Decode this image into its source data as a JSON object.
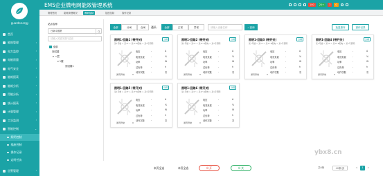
{
  "app": {
    "title": "EMS企业微电网能效管理系统",
    "username": "guardenergy",
    "brand_color": "#1ba3a6",
    "watermark": "ybx8.cn"
  },
  "topbar": {
    "badges": [
      {
        "label": "100",
        "color": "#e74c3c"
      },
      {
        "label": "20+",
        "color": "#27ae60"
      },
      {
        "label": "7",
        "color": "#e74c3c"
      },
      {
        "label": "0",
        "color": "#f39c12"
      }
    ]
  },
  "sidebar": {
    "items": [
      {
        "label": "首页",
        "icon": "home-icon",
        "has_chevron": false
      },
      {
        "label": "能耗管理",
        "icon": "energy-icon",
        "has_chevron": true
      },
      {
        "label": "电力监控",
        "icon": "monitor-icon",
        "has_chevron": true
      },
      {
        "label": "电能质量",
        "icon": "quality-icon",
        "has_chevron": true
      },
      {
        "label": "电气安全",
        "icon": "safety-icon",
        "has_chevron": true
      },
      {
        "label": "能耗报表",
        "icon": "report-icon",
        "has_chevron": true
      },
      {
        "label": "能耗分析",
        "icon": "analysis-icon",
        "has_chevron": true
      },
      {
        "label": "用能分析",
        "icon": "usage-icon",
        "has_chevron": true
      },
      {
        "label": "统计报表",
        "icon": "stats-icon",
        "has_chevron": true
      },
      {
        "label": "计量管理",
        "icon": "meter-icon",
        "has_chevron": true
      },
      {
        "label": "工况监测",
        "icon": "condition-icon",
        "has_chevron": true
      },
      {
        "label": "智能控制",
        "icon": "control-icon",
        "has_chevron": true,
        "expanded": true
      }
    ],
    "subitems": [
      {
        "label": "照明控制",
        "active": true
      },
      {
        "label": "插座控制",
        "active": false
      },
      {
        "label": "操作记录",
        "active": false
      },
      {
        "label": "定时任务",
        "active": false
      }
    ],
    "bottom_items": [
      {
        "label": "告警管理",
        "icon": "alarm-icon"
      },
      {
        "label": "运维管理",
        "icon": "ops-icon"
      }
    ]
  },
  "tabs": [
    {
      "label": "管理首页",
      "active": false
    },
    {
      "label": "能耗管理概况",
      "active": false
    },
    {
      "label": "照明控制",
      "active": true
    },
    {
      "label": "插座控制",
      "active": false
    },
    {
      "label": "操作记录",
      "active": false
    }
  ],
  "leftpanel": {
    "label": "站点名称",
    "site_value": "日新中国厦",
    "search_placeholder": "请输入关键字进行过滤",
    "tree": [
      {
        "label": "全部",
        "level": 0,
        "checked": true
      },
      {
        "label": "测试楼",
        "level": 1,
        "checked": false
      },
      {
        "label": "▾  一层",
        "level": 2,
        "checked": false
      },
      {
        "label": "▾  1楼",
        "level": 3,
        "checked": false
      },
      {
        "label": "测试楼1",
        "level": 4,
        "checked": false
      }
    ]
  },
  "filters": {
    "group1": [
      {
        "label": "全部",
        "active": true
      },
      {
        "label": "分闸",
        "active": false
      },
      {
        "label": "合闸",
        "active": false
      }
    ],
    "status_label": "通讯:",
    "group2": [
      {
        "label": "全部",
        "active": true
      },
      {
        "label": "正常",
        "active": false
      },
      {
        "label": "异常",
        "active": false
      }
    ],
    "search_placeholder": "请输入设备名称",
    "query_label": "查询",
    "batch_label": "批量操作",
    "record_label": "操作记录"
  },
  "cards": [
    {
      "title": "照明1-回路1 (带开关)",
      "sub": "某1号楼 > 某1F > 某1F-B配电 > 某1号照明",
      "button": "分闸",
      "comm_label": "通讯异常",
      "comm_value": "0",
      "rows": [
        {
          "name": "电压",
          "dash": "-",
          "unit": "A"
        },
        {
          "name": "电流负载",
          "dash": "-",
          "unit": "%"
        },
        {
          "name": "功率",
          "dash": "-",
          "unit": "W"
        },
        {
          "name": "过负荷",
          "dash": "-",
          "unit": "h"
        },
        {
          "name": "动作次数",
          "dash": "-",
          "unit": "次"
        }
      ]
    },
    {
      "title": "照明1-回路2 (带开关)",
      "sub": "某1号楼 > 某1F > 某1F-B配电 > 某1号照明",
      "button": "分闸",
      "comm_label": "通讯异常",
      "comm_value": "0",
      "rows": [
        {
          "name": "电压",
          "dash": "-",
          "unit": "A"
        },
        {
          "name": "电流负载",
          "dash": "-",
          "unit": "%"
        },
        {
          "name": "功率",
          "dash": "-",
          "unit": "W"
        },
        {
          "name": "过负荷",
          "dash": "-",
          "unit": "h"
        },
        {
          "name": "动作次数",
          "dash": "-",
          "unit": "次"
        }
      ]
    },
    {
      "title": "照明1-回路3 (带开关)",
      "sub": "某1号楼 > 某1F > 某1F-B配电 > 某1号照明",
      "button": "分闸",
      "comm_label": "通讯异常",
      "comm_value": "0",
      "rows": [
        {
          "name": "电压",
          "dash": "-",
          "unit": "A"
        },
        {
          "name": "电流负载",
          "dash": "-",
          "unit": "%"
        },
        {
          "name": "功率",
          "dash": "-",
          "unit": "W"
        },
        {
          "name": "过负荷",
          "dash": "-",
          "unit": "h"
        },
        {
          "name": "动作次数",
          "dash": "-",
          "unit": "次"
        }
      ]
    },
    {
      "title": "照明1-回路4 (带开关)",
      "sub": "某1号楼 > 某1F > 某1F-B配电 > 某1号照明",
      "button": "分闸",
      "comm_label": "通讯异常",
      "comm_value": "0",
      "rows": [
        {
          "name": "电压",
          "dash": "-",
          "unit": "A"
        },
        {
          "name": "电流负载",
          "dash": "-",
          "unit": "%"
        },
        {
          "name": "功率",
          "dash": "-",
          "unit": "W"
        },
        {
          "name": "过负荷",
          "dash": "-",
          "unit": "h"
        },
        {
          "name": "动作次数",
          "dash": "-",
          "unit": "次"
        }
      ]
    },
    {
      "title": "照明1-回路5 (带开关)",
      "sub": "某1号楼 > 某1F > 某1F-B配电 > 某1号照明",
      "button": "分闸",
      "comm_label": "通讯异常",
      "comm_value": "0",
      "rows": [
        {
          "name": "电压",
          "dash": "-",
          "unit": "A"
        },
        {
          "name": "电流负载",
          "dash": "-",
          "unit": "%"
        },
        {
          "name": "功率",
          "dash": "-",
          "unit": "W"
        },
        {
          "name": "过负荷",
          "dash": "-",
          "unit": "h"
        },
        {
          "name": "动作次数",
          "dash": "-",
          "unit": "次"
        }
      ]
    },
    {
      "title": "照明1-回路6 (带开关)",
      "sub": "某1号楼 > 某1F > 某1F-B配电 > 某1号照明",
      "button": "分闸",
      "comm_label": "通讯异常",
      "comm_value": "0",
      "rows": [
        {
          "name": "电压",
          "dash": "-",
          "unit": "A"
        },
        {
          "name": "电流负载",
          "dash": "-",
          "unit": "%"
        },
        {
          "name": "功率",
          "dash": "-",
          "unit": "W"
        },
        {
          "name": "过负荷",
          "dash": "-",
          "unit": "h"
        },
        {
          "name": "动作次数",
          "dash": "-",
          "unit": "次"
        }
      ]
    }
  ],
  "bottom": {
    "select_all": "本页全选",
    "select_page": "本页全选",
    "on_label": "开",
    "off_label": "关",
    "total": "共6条",
    "page_size": "40条/页",
    "prev": "<",
    "page": "1",
    "next": ">"
  }
}
